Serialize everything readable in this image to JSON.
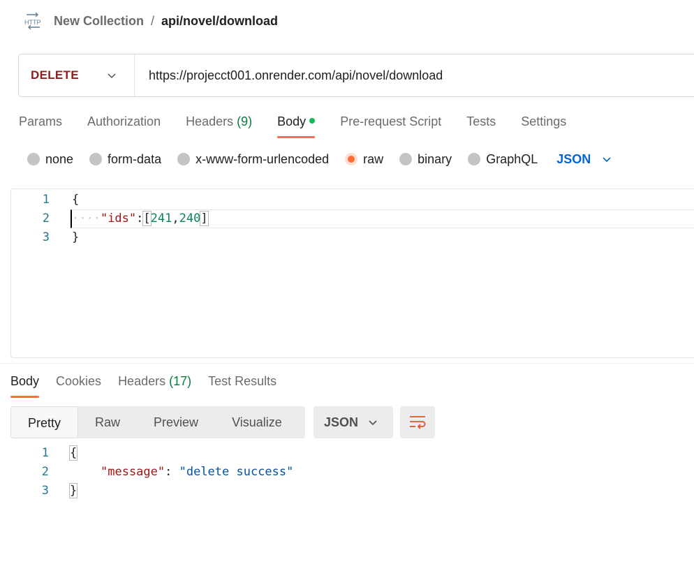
{
  "breadcrumb": {
    "icon": "http-icon",
    "collection": "New Collection",
    "separator": "/",
    "request": "api/novel/download"
  },
  "urlbar": {
    "method": "DELETE",
    "url": "https://projecct001.onrender.com/api/novel/download",
    "method_color": "#8f1d1d"
  },
  "request_tabs": [
    {
      "label": "Params",
      "count": ""
    },
    {
      "label": "Authorization",
      "count": ""
    },
    {
      "label": "Headers",
      "count": "(9)"
    },
    {
      "label": "Body",
      "count": "",
      "active": true,
      "indicator": "green-dot"
    },
    {
      "label": "Pre-request Script",
      "count": ""
    },
    {
      "label": "Tests",
      "count": ""
    },
    {
      "label": "Settings",
      "count": ""
    }
  ],
  "body_types": {
    "options": [
      "none",
      "form-data",
      "x-www-form-urlencoded",
      "raw",
      "binary",
      "GraphQL"
    ],
    "selected": "raw",
    "language": "JSON"
  },
  "request_body": {
    "line_numbers": [
      "1",
      "2",
      "3"
    ],
    "lines": [
      "{",
      "\"ids\":[241,240]",
      "}"
    ],
    "whitespace_marker": "····",
    "key": "\"ids\"",
    "colon": ":",
    "open_bracket": "[",
    "value1": "241",
    "comma": ",",
    "value2": "240",
    "close_bracket": "]"
  },
  "response_tabs": [
    {
      "label": "Body",
      "count": "",
      "active": true
    },
    {
      "label": "Cookies",
      "count": ""
    },
    {
      "label": "Headers",
      "count": "(17)"
    },
    {
      "label": "Test Results",
      "count": ""
    }
  ],
  "response_view": {
    "modes": [
      "Pretty",
      "Raw",
      "Preview",
      "Visualize"
    ],
    "selected": "Pretty",
    "format": "JSON",
    "wrap_icon": "wrap-lines-icon"
  },
  "response_body": {
    "line_numbers": [
      "1",
      "2",
      "3"
    ],
    "open": "{",
    "key": "\"message\"",
    "colon": ": ",
    "value": "\"delete success\"",
    "close": "}"
  },
  "colors": {
    "accent": "#ff6c37",
    "link_blue": "#0265d2",
    "count_green": "#0a7d3b"
  }
}
